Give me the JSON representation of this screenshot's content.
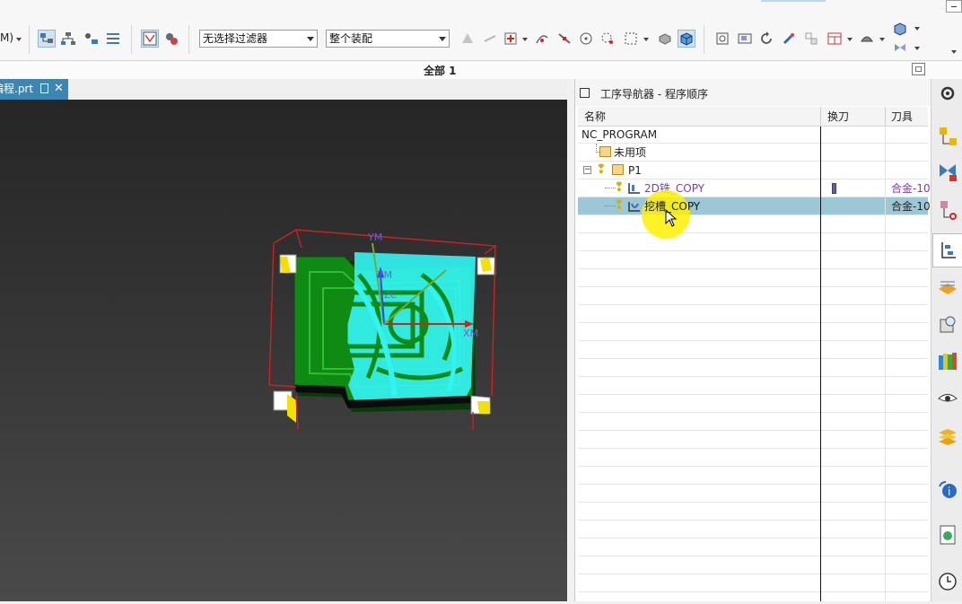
{
  "toolbar": {
    "left_partial": "M)",
    "filter_select": "无选择过滤器",
    "assembly_select": "整个装配"
  },
  "selection_bar": {
    "label": "全部 1"
  },
  "document_tab": {
    "label": "编程.prt"
  },
  "navigator": {
    "title": "工序导航器 - 程序顺序",
    "columns": {
      "name": "名称",
      "tool_change": "换刀",
      "tool": "刀具"
    },
    "rows": [
      {
        "name": "NC_PROGRAM",
        "tool": ""
      },
      {
        "name": "未用项",
        "tool": ""
      },
      {
        "name": "P1",
        "tool": ""
      },
      {
        "name": "2D铣_COPY",
        "tool": "合金-10"
      },
      {
        "name": "挖槽_COPY",
        "tool": "合金-10"
      }
    ]
  },
  "viewport": {
    "axis_labels": {
      "ym": "YM",
      "zm": "ZM",
      "xm": "XM",
      "zc": "ZC"
    }
  },
  "colors": {
    "accent": "#3c86b4",
    "selected_row": "#9cc7d6",
    "part_green": "#0f8a12",
    "toolpath_cyan": "#33f2f2",
    "item_text_purple": "#7a3db8"
  }
}
